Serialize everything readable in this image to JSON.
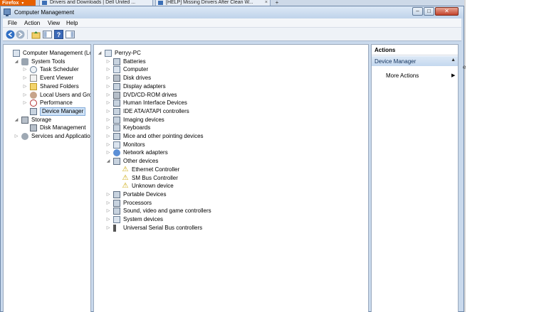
{
  "browser": {
    "firefox_label": "Firefox",
    "tabs": [
      {
        "title": "Drivers and Downloads | Dell United ..."
      },
      {
        "title": "[HELP] Missing Drivers After Clean W..."
      }
    ],
    "new_tab": "+"
  },
  "window": {
    "title": "Computer Management",
    "minimize": "–",
    "maximize": "□",
    "close": "✕"
  },
  "menu": [
    "File",
    "Action",
    "View",
    "Help"
  ],
  "toolbar": {
    "help_glyph": "?"
  },
  "left_tree": [
    {
      "label": "Computer Management (Local",
      "icon": "computer-management-icon",
      "level": 0,
      "expander": ""
    },
    {
      "label": "System Tools",
      "icon": "system-tools-icon",
      "level": 1,
      "expander": "◢"
    },
    {
      "label": "Task Scheduler",
      "icon": "task-scheduler-icon",
      "level": 2,
      "expander": "▷"
    },
    {
      "label": "Event Viewer",
      "icon": "event-viewer-icon",
      "level": 2,
      "expander": "▷"
    },
    {
      "label": "Shared Folders",
      "icon": "shared-folders-icon",
      "level": 2,
      "expander": "▷"
    },
    {
      "label": "Local Users and Groups",
      "icon": "local-users-icon",
      "level": 2,
      "expander": "▷"
    },
    {
      "label": "Performance",
      "icon": "performance-icon",
      "level": 2,
      "expander": "▷"
    },
    {
      "label": "Device Manager",
      "icon": "device-manager-icon",
      "level": 2,
      "expander": "",
      "selected": true
    },
    {
      "label": "Storage",
      "icon": "storage-icon",
      "level": 1,
      "expander": "◢"
    },
    {
      "label": "Disk Management",
      "icon": "disk-management-icon",
      "level": 2,
      "expander": ""
    },
    {
      "label": "Services and Applications",
      "icon": "services-icon",
      "level": 1,
      "expander": "▷"
    }
  ],
  "device_tree": [
    {
      "label": "Perryy-PC",
      "icon": "computer-icon",
      "level": 0,
      "expander": "◢"
    },
    {
      "label": "Batteries",
      "icon": "battery-icon",
      "level": 1,
      "expander": "▷"
    },
    {
      "label": "Computer",
      "icon": "computer-icon",
      "level": 1,
      "expander": "▷"
    },
    {
      "label": "Disk drives",
      "icon": "disk-drive-icon",
      "level": 1,
      "expander": "▷"
    },
    {
      "label": "Display adapters",
      "icon": "display-adapter-icon",
      "level": 1,
      "expander": "▷"
    },
    {
      "label": "DVD/CD-ROM drives",
      "icon": "dvd-drive-icon",
      "level": 1,
      "expander": "▷"
    },
    {
      "label": "Human Interface Devices",
      "icon": "hid-icon",
      "level": 1,
      "expander": "▷"
    },
    {
      "label": "IDE ATA/ATAPI controllers",
      "icon": "ide-controller-icon",
      "level": 1,
      "expander": "▷"
    },
    {
      "label": "Imaging devices",
      "icon": "imaging-device-icon",
      "level": 1,
      "expander": "▷"
    },
    {
      "label": "Keyboards",
      "icon": "keyboard-icon",
      "level": 1,
      "expander": "▷"
    },
    {
      "label": "Mice and other pointing devices",
      "icon": "mouse-icon",
      "level": 1,
      "expander": "▷"
    },
    {
      "label": "Monitors",
      "icon": "monitor-icon",
      "level": 1,
      "expander": "▷"
    },
    {
      "label": "Network adapters",
      "icon": "network-adapter-icon",
      "level": 1,
      "expander": "▷"
    },
    {
      "label": "Other devices",
      "icon": "other-devices-icon",
      "level": 1,
      "expander": "◢"
    },
    {
      "label": "Ethernet Controller",
      "icon": "warning-device-icon",
      "level": 2,
      "expander": "",
      "warning": true
    },
    {
      "label": "SM Bus Controller",
      "icon": "warning-device-icon",
      "level": 2,
      "expander": "",
      "warning": true
    },
    {
      "label": "Unknown device",
      "icon": "warning-device-icon",
      "level": 2,
      "expander": "",
      "warning": true
    },
    {
      "label": "Portable Devices",
      "icon": "portable-device-icon",
      "level": 1,
      "expander": "▷"
    },
    {
      "label": "Processors",
      "icon": "processor-icon",
      "level": 1,
      "expander": "▷"
    },
    {
      "label": "Sound, video and game controllers",
      "icon": "sound-icon",
      "level": 1,
      "expander": "▷"
    },
    {
      "label": "System devices",
      "icon": "system-device-icon",
      "level": 1,
      "expander": "▷"
    },
    {
      "label": "Universal Serial Bus controllers",
      "icon": "usb-icon",
      "level": 1,
      "expander": "▷"
    }
  ],
  "actions": {
    "header": "Actions",
    "section": "Device Manager",
    "more": "More Actions",
    "more_arrow": "▶",
    "collapse": "▲"
  },
  "side_letter": "e",
  "colors": {
    "selection": "#cfe3f8",
    "warning": "#c9a400",
    "close_button": "#c2432c"
  }
}
